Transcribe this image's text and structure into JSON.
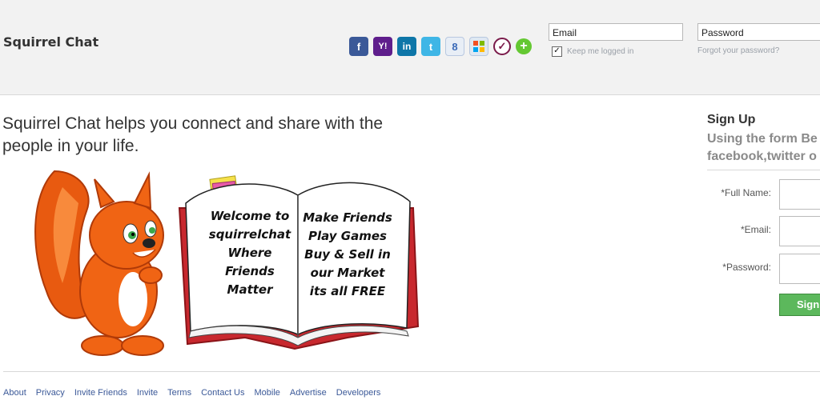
{
  "header": {
    "brand": "Squirrel Chat",
    "social_icons": [
      "facebook-icon",
      "yahoo-icon",
      "linkedin-icon",
      "twitter-icon",
      "google-icon",
      "windows-live-icon",
      "check-icon",
      "add-icon"
    ],
    "social_glyphs": {
      "facebook": "f",
      "yahoo": "Y!",
      "linkedin": "in",
      "twitter": "t",
      "google": "8",
      "windows": "⊞",
      "check": "✓",
      "add": "+"
    },
    "email_placeholder": "Email",
    "password_placeholder": "Password",
    "keep_logged_in": "Keep me logged in",
    "forgot_password": "Forgot your password?"
  },
  "main": {
    "tagline": "Squirrel Chat helps you connect and share with the people in your life.",
    "book_left": [
      "Welcome to",
      "squirrelchat",
      "Where",
      "Friends",
      "Matter"
    ],
    "book_right": [
      "Make Friends",
      "Play Games",
      "Buy & Sell in",
      "our Market",
      "its all FREE"
    ]
  },
  "signup": {
    "title": "Sign Up",
    "subtitle_line1": "Using the form Be",
    "subtitle_line2": "facebook,twitter o",
    "full_name_label": "*Full Name:",
    "email_label": "*Email:",
    "password_label": "*Password:",
    "button": "Sign"
  },
  "footer": {
    "links": [
      "About",
      "Privacy",
      "Invite Friends",
      "Invite",
      "Terms",
      "Contact Us",
      "Mobile",
      "Advertise",
      "Developers"
    ]
  },
  "colors": {
    "header_bg": "#f2f2f2",
    "link": "#3b5998",
    "signup_button": "#5cb85c",
    "book_cover": "#c8282e",
    "squirrel": "#f06414"
  }
}
